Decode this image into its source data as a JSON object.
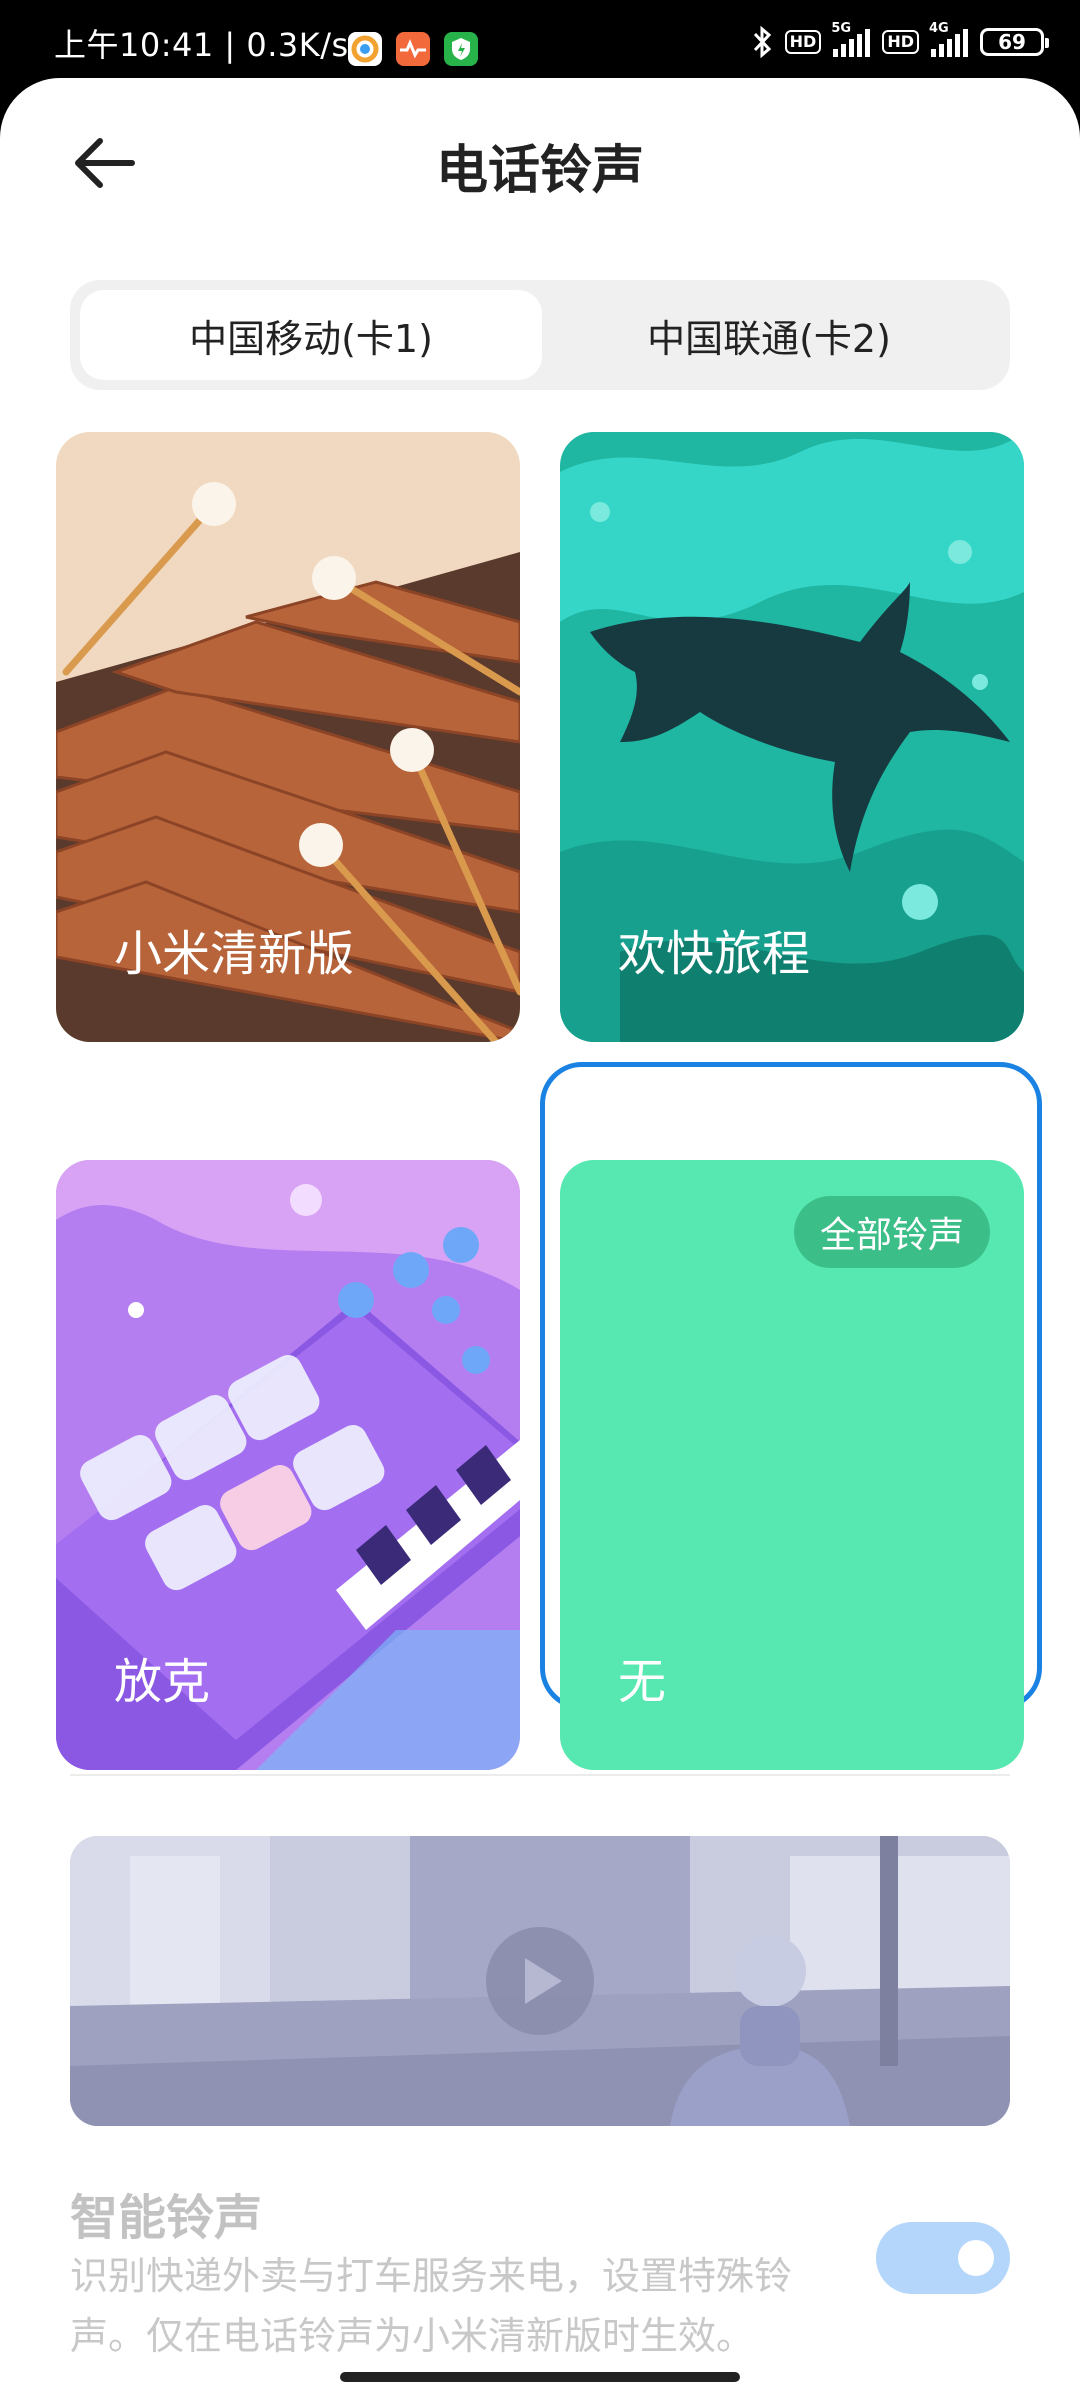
{
  "status_bar": {
    "time_and_speed": "上午10:41 | 0.3K/s",
    "hd1": "HD",
    "net1": "5G",
    "hd2": "HD",
    "net2": "4G",
    "battery": "69"
  },
  "header": {
    "title": "电话铃声",
    "back_icon": "arrow-left-icon"
  },
  "sim_tabs": [
    {
      "label": "中国移动(卡1)",
      "active": true
    },
    {
      "label": "中国联通(卡2)",
      "active": false
    }
  ],
  "ringtones": [
    {
      "label": "小米清新版",
      "art": "xylophone"
    },
    {
      "label": "欢快旅程",
      "art": "shark"
    },
    {
      "label": "放克",
      "art": "synth-pads"
    },
    {
      "label": "无",
      "art": "plain",
      "badge": "全部铃声",
      "selected": true
    }
  ],
  "smart_ringtone": {
    "title": "智能铃声",
    "description": "识别快递外卖与打车服务来电，设置特殊铃声。仅在电话铃声为小米清新版时生效。",
    "enabled": true
  },
  "colors": {
    "selected_ring": "#1a82e2",
    "plain_card": "#56e8b0",
    "badge": "#3cbe88",
    "toggle": "#b5d6fb"
  }
}
